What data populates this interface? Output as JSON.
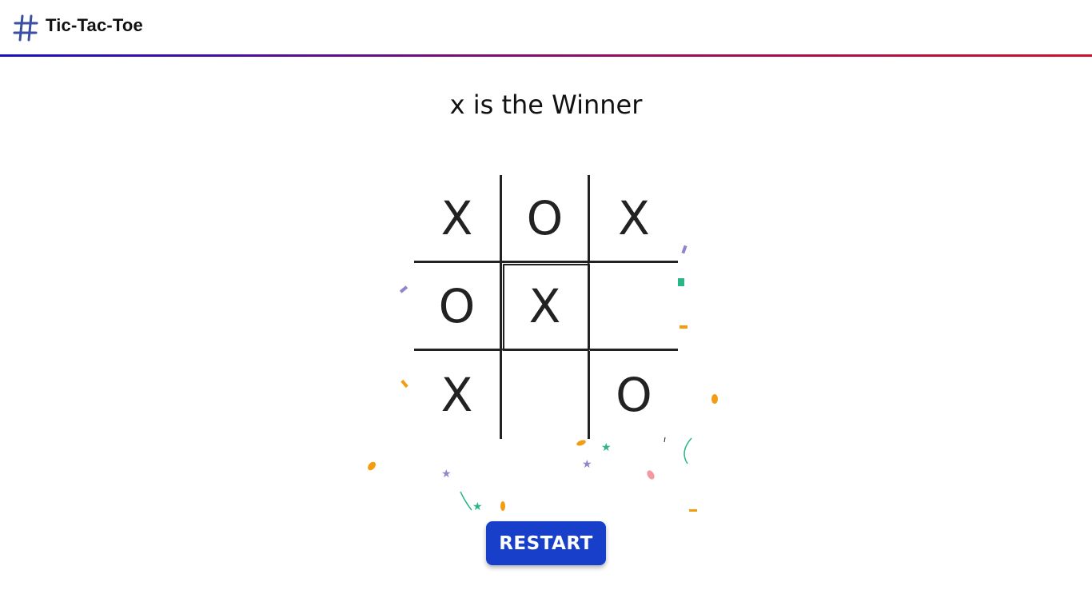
{
  "header": {
    "title": "Tic-Tac-Toe",
    "logo_icon": "hash-icon",
    "gradient_colors": [
      "#1a0fc4",
      "#d0102a"
    ]
  },
  "game": {
    "status": "x is the Winner",
    "board": [
      [
        "X",
        "O",
        "X"
      ],
      [
        "O",
        "X",
        ""
      ],
      [
        "X",
        "",
        "O"
      ]
    ]
  },
  "controls": {
    "restart_label": "RESTART",
    "restart_color": "#173fc9"
  },
  "confetti_colors": [
    "#f39c12",
    "#2bb58a",
    "#8e86c8",
    "#f29aa0"
  ]
}
